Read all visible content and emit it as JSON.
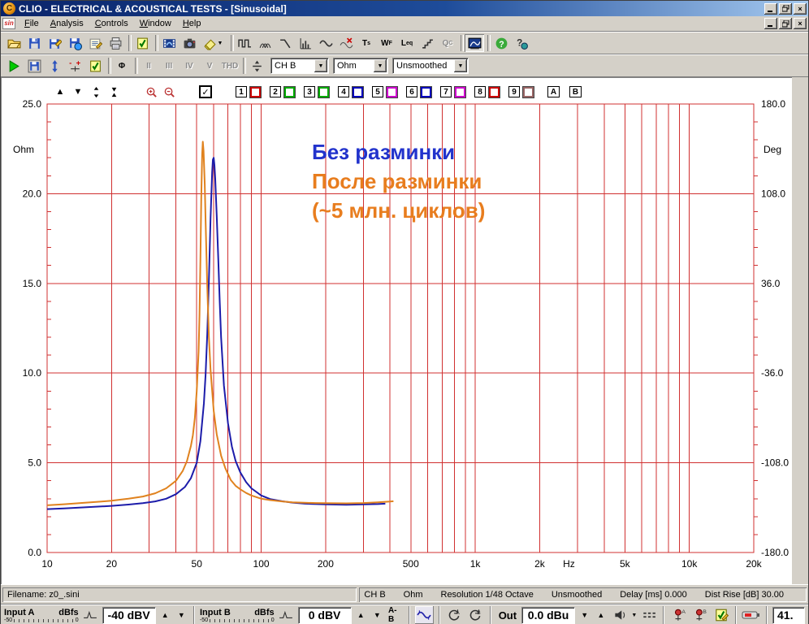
{
  "window": {
    "title": "CLIO - ELECTRICAL & ACOUSTICAL TESTS - [Sinusoidal]",
    "logo_letter": "C",
    "mdi_icon_text": "sin"
  },
  "menu": {
    "items": [
      {
        "label": "File",
        "hotkey": "F"
      },
      {
        "label": "Analysis",
        "hotkey": "A"
      },
      {
        "label": "Controls",
        "hotkey": "C"
      },
      {
        "label": "Window",
        "hotkey": "W"
      },
      {
        "label": "Help",
        "hotkey": "H"
      }
    ]
  },
  "toolbar_main": {
    "buttons": [
      {
        "name": "open-button",
        "icon": "folder"
      },
      {
        "name": "save-button",
        "icon": "floppy"
      },
      {
        "name": "save-as-button",
        "icon": "floppy-pencil"
      },
      {
        "name": "save-data-button",
        "icon": "floppy-ball"
      },
      {
        "name": "export-notes-button",
        "icon": "notes"
      },
      {
        "name": "print-button",
        "icon": "printer"
      },
      {
        "sep": true
      },
      {
        "name": "options-button",
        "icon": "check-doc"
      },
      {
        "sep": true
      },
      {
        "name": "film-button",
        "icon": "film"
      },
      {
        "name": "snapshot-button",
        "icon": "camera"
      },
      {
        "name": "erase-button",
        "icon": "eraser",
        "dropdown": true
      },
      {
        "sep": true
      },
      {
        "name": "mls-button",
        "icon": "square-wave"
      },
      {
        "name": "waterfall-button",
        "icon": "waterfall"
      },
      {
        "name": "decay-button",
        "icon": "slope"
      },
      {
        "name": "ln-analysis-button",
        "icon": "bars"
      },
      {
        "name": "sinusoidal-button",
        "icon": "sine"
      },
      {
        "name": "sine-off-button",
        "icon": "sine-off"
      },
      {
        "name": "ts-parameters-button",
        "text": "T",
        "sub": "s"
      },
      {
        "name": "wf-button",
        "text": "W",
        "sub": "F"
      },
      {
        "name": "leq-button",
        "text": "L",
        "sub": "eq"
      },
      {
        "name": "steps-button",
        "icon": "stairs"
      },
      {
        "name": "qc-button",
        "text": "Q",
        "sub": "C",
        "disabled": true
      },
      {
        "sep": true
      },
      {
        "name": "graph-window-button",
        "icon": "graph-window",
        "pressed": true
      },
      {
        "sep": true
      },
      {
        "name": "help-button",
        "icon": "help"
      },
      {
        "name": "about-button",
        "icon": "about"
      }
    ]
  },
  "toolbar_measure": {
    "buttons": [
      {
        "name": "go-button",
        "icon": "play"
      },
      {
        "name": "autosave-button",
        "icon": "floppy-frame"
      },
      {
        "name": "autoscale-button",
        "icon": "autoscale"
      },
      {
        "name": "offset-button",
        "icon": "plus-minus"
      },
      {
        "name": "settings-button",
        "icon": "check-doc"
      },
      {
        "sep": true
      },
      {
        "name": "phase-button",
        "text": "Φ"
      },
      {
        "sep": true
      },
      {
        "name": "harmonic-2-button",
        "text": "II",
        "disabled": true
      },
      {
        "name": "harmonic-3-button",
        "text": "III",
        "disabled": true
      },
      {
        "name": "harmonic-4-button",
        "text": "IV",
        "disabled": true
      },
      {
        "name": "harmonic-5-button",
        "text": "V",
        "disabled": true
      },
      {
        "name": "thd-button",
        "text": "THD",
        "disabled": true
      },
      {
        "sep": true
      },
      {
        "name": "divide-button",
        "icon": "divide"
      }
    ],
    "channel_select": "CH B",
    "unit_select": "Ohm",
    "smoothing_select": "Unsmoothed"
  },
  "graph_controls": {
    "main_check": "✓",
    "overlays": [
      {
        "num": "1",
        "color": "#cc0000"
      },
      {
        "num": "2",
        "color": "#00aa00"
      },
      {
        "num": "3",
        "color": "#00aa00"
      },
      {
        "num": "4",
        "color": "#0000bb"
      },
      {
        "num": "5",
        "color": "#cc00cc"
      },
      {
        "num": "6",
        "color": "#0000bb"
      },
      {
        "num": "7",
        "color": "#cc00cc"
      },
      {
        "num": "8",
        "color": "#cc0000"
      },
      {
        "num": "9",
        "color": "#996666"
      }
    ],
    "memory_buttons": [
      "A",
      "B"
    ]
  },
  "chart_data": {
    "type": "line",
    "x_axis": {
      "label": "Hz",
      "scale": "log",
      "min": 10,
      "max": 20000,
      "tick_labels": [
        "10",
        "20",
        "50",
        "100",
        "200",
        "500",
        "1k",
        "2k",
        "5k",
        "10k",
        "20k"
      ],
      "tick_values": [
        10,
        20,
        50,
        100,
        200,
        500,
        1000,
        2000,
        5000,
        10000,
        20000
      ]
    },
    "y_left": {
      "label": "Ohm",
      "min": 0,
      "max": 25,
      "tick_labels": [
        "25.0",
        "20.0",
        "15.0",
        "10.0",
        "5.0",
        "0.0"
      ],
      "tick_values": [
        25,
        20,
        15,
        10,
        5,
        0
      ]
    },
    "y_right": {
      "label": "Deg",
      "min": -180,
      "max": 180,
      "tick_labels": [
        "180.0",
        "108.0",
        "36.0",
        "-36.0",
        "-108.0",
        "-180.0"
      ]
    },
    "grid_color": "#d03030",
    "grid": true,
    "series": [
      {
        "name": "Без разминки",
        "color": "#1c1caa",
        "points": [
          [
            10,
            2.42
          ],
          [
            12,
            2.46
          ],
          [
            15,
            2.52
          ],
          [
            18,
            2.57
          ],
          [
            20,
            2.6
          ],
          [
            24,
            2.67
          ],
          [
            28,
            2.75
          ],
          [
            32,
            2.85
          ],
          [
            36,
            3.0
          ],
          [
            40,
            3.25
          ],
          [
            44,
            3.65
          ],
          [
            47,
            4.15
          ],
          [
            50,
            5.0
          ],
          [
            52,
            6.2
          ],
          [
            54,
            8.3
          ],
          [
            55,
            9.9
          ],
          [
            56,
            12.2
          ],
          [
            57,
            15.2
          ],
          [
            58,
            18.6
          ],
          [
            59,
            21.2
          ],
          [
            59.5,
            21.9
          ],
          [
            60,
            22.0
          ],
          [
            60.5,
            21.6
          ],
          [
            61,
            20.8
          ],
          [
            62,
            18.8
          ],
          [
            63,
            16.4
          ],
          [
            64,
            14.0
          ],
          [
            65,
            12.0
          ],
          [
            67,
            9.3
          ],
          [
            70,
            7.2
          ],
          [
            73,
            5.9
          ],
          [
            76,
            5.1
          ],
          [
            80,
            4.45
          ],
          [
            85,
            3.92
          ],
          [
            90,
            3.58
          ],
          [
            100,
            3.18
          ],
          [
            110,
            2.98
          ],
          [
            125,
            2.86
          ],
          [
            140,
            2.78
          ],
          [
            160,
            2.72
          ],
          [
            180,
            2.7
          ],
          [
            200,
            2.68
          ],
          [
            250,
            2.66
          ],
          [
            300,
            2.68
          ],
          [
            350,
            2.7
          ],
          [
            380,
            2.72
          ]
        ]
      },
      {
        "name": "После разминки (~5 млн. циклов)",
        "color": "#e0821e",
        "points": [
          [
            10,
            2.63
          ],
          [
            12,
            2.69
          ],
          [
            15,
            2.77
          ],
          [
            18,
            2.84
          ],
          [
            20,
            2.89
          ],
          [
            24,
            3.0
          ],
          [
            28,
            3.12
          ],
          [
            32,
            3.3
          ],
          [
            36,
            3.58
          ],
          [
            40,
            4.0
          ],
          [
            43,
            4.55
          ],
          [
            45,
            5.1
          ],
          [
            47,
            5.95
          ],
          [
            48,
            6.55
          ],
          [
            49,
            7.5
          ],
          [
            50,
            9.0
          ],
          [
            51,
            11.2
          ],
          [
            51.5,
            13.2
          ],
          [
            52,
            16.2
          ],
          [
            52.5,
            19.8
          ],
          [
            53,
            22.2
          ],
          [
            53.4,
            22.9
          ],
          [
            53.8,
            22.4
          ],
          [
            54.5,
            20.5
          ],
          [
            55,
            18.5
          ],
          [
            56,
            14.8
          ],
          [
            57,
            12.0
          ],
          [
            58,
            10.2
          ],
          [
            60,
            7.9
          ],
          [
            62,
            6.6
          ],
          [
            65,
            5.4
          ],
          [
            68,
            4.7
          ],
          [
            72,
            4.05
          ],
          [
            76,
            3.72
          ],
          [
            80,
            3.52
          ],
          [
            85,
            3.32
          ],
          [
            90,
            3.18
          ],
          [
            100,
            3.0
          ],
          [
            110,
            2.92
          ],
          [
            125,
            2.85
          ],
          [
            140,
            2.8
          ],
          [
            160,
            2.77
          ],
          [
            180,
            2.76
          ],
          [
            200,
            2.75
          ],
          [
            250,
            2.74
          ],
          [
            300,
            2.76
          ],
          [
            350,
            2.8
          ],
          [
            400,
            2.84
          ],
          [
            415,
            2.86
          ]
        ]
      }
    ],
    "annotations": [
      {
        "text": "Без разминки",
        "color": "#2233cc"
      },
      {
        "text": "После разминки",
        "color": "#e87d1e"
      },
      {
        "text": "(~5 млн. циклов)",
        "color": "#e87d1e"
      }
    ]
  },
  "status_bar": {
    "filename": "Filename: z0_.sini",
    "items": [
      "CH B",
      "Ohm",
      "Resolution 1/48 Octave",
      "Unsmoothed",
      "Delay [ms] 0.000",
      "Dist Rise [dB] 30.00"
    ]
  },
  "bottom_bar": {
    "input_a_label": "Input A",
    "input_b_label": "Input B",
    "dbfs_label": "dBfs",
    "scale_min": "-50",
    "scale_max": "0",
    "input_a_value": "-40 dBV",
    "input_b_value": "0 dBV",
    "ab_label": "A-B",
    "out_label": "Out",
    "out_value": "0.0 dBu",
    "right_value": "41."
  }
}
